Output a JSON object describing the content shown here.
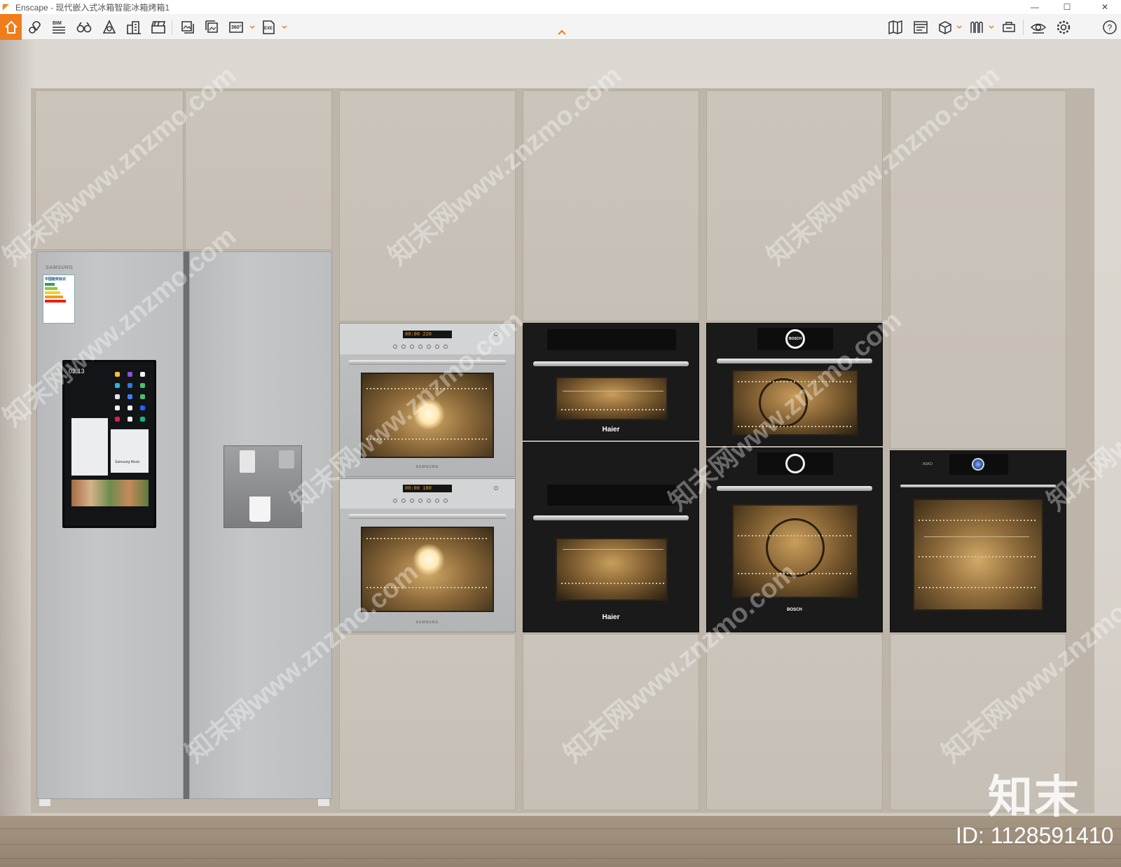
{
  "window": {
    "title": "Enscape - 现代嵌入式冰箱智能冰箱烤箱1",
    "minimize": "—",
    "maximize": "☐",
    "close": "✕"
  },
  "toolbar": {
    "left_tools": [
      "home-icon",
      "asset-pin-icon",
      "bim-icon",
      "binoculars-icon",
      "light-view-icon",
      "building-icon",
      "clapperboard-icon"
    ],
    "export_tools": [
      "screenshot-icon",
      "batch-render-icon",
      "panorama-360-icon",
      "exe-export-icon"
    ],
    "bim_label": "BIM",
    "pano_label": "360°",
    "exe_label": "EXE",
    "right_tools": [
      "map-icon",
      "atmosphere-icon",
      "view-box-icon",
      "materials-icon",
      "capture-icon",
      "visual-settings-icon",
      "settings-icon",
      "help-icon"
    ],
    "help_label": "?",
    "accent_color": "#f07d1a"
  },
  "scene": {
    "fridge": {
      "brand": "SAMSUNG",
      "energy_label_title": "中国能效标识",
      "screen_time": "02 13",
      "screen_widget_caption": "Samsung Music"
    },
    "ovens": {
      "samsung_brand": "SAMSUNG",
      "samsung_display_1": "00:00 220",
      "samsung_display_2": "00:00 180",
      "haier_brand": "Haier",
      "bosch_brand": "BOSCH",
      "bosch_ring_label": "BOSCH",
      "aeg_brand": "ASKO"
    },
    "watermark_text": "知末网www.znzmo.com",
    "logo_text": "知末",
    "id_text": "ID: 1128591410"
  }
}
